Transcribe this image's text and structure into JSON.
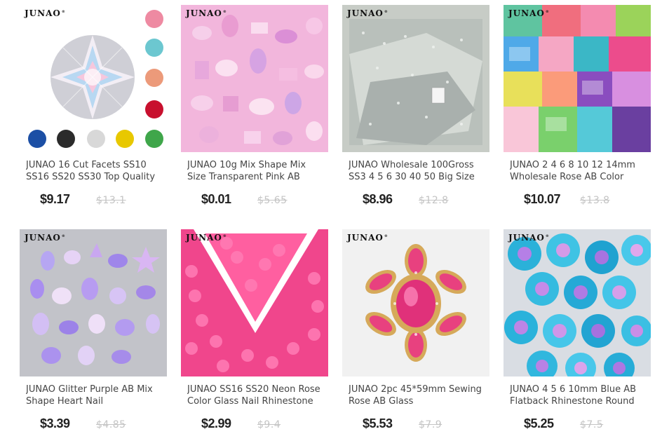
{
  "brand_mark": "JUNAO",
  "products": [
    {
      "title": "JUNAO 16 Cut Facets SS10 SS16 SS20 SS30 Top Quality",
      "price": "$9.17",
      "old_price": "$13.1",
      "image": "ab-crystal-with-color-swatches"
    },
    {
      "title": "JUNAO 10g Mix Shape Mix Size Transparent Pink AB",
      "price": "$0.01",
      "old_price": "$5.65",
      "image": "pink-ab-mixed-shapes"
    },
    {
      "title": "JUNAO Wholesale 100Gross SS3 4 5 6 30 40 50 Big Size",
      "price": "$8.96",
      "old_price": "$12.8",
      "image": "silver-ab-bulk-bags"
    },
    {
      "title": "JUNAO 2 4 6 8 10 12 14mm Wholesale Rose AB Color",
      "price": "$10.07",
      "old_price": "$13.8",
      "image": "multicolor-bags"
    },
    {
      "title": "JUNAO Glitter Purple AB Mix Shape Heart Nail",
      "price": "$3.39",
      "old_price": "$4.85",
      "image": "purple-ab-mixed-shapes"
    },
    {
      "title": "JUNAO SS16 SS20 Neon Rose Color Glass Nail Rhinestone",
      "price": "$2.99",
      "old_price": "$9.4",
      "image": "neon-rose-rhinestones"
    },
    {
      "title": "JUNAO 2pc 45*59mm Sewing Rose AB Glass",
      "price": "$5.53",
      "old_price": "$7.9",
      "image": "rose-ab-applique"
    },
    {
      "title": "JUNAO 4 5 6 10mm Blue AB Flatback Rhinestone Round",
      "price": "$5.25",
      "old_price": "$7.5",
      "image": "blue-ab-cones"
    }
  ],
  "colors": {
    "title_text": "#444444",
    "price_text": "#222222",
    "old_price_text": "#c4c4c4",
    "swatches": [
      "#ee8aa2",
      "#6cc7d0",
      "#ec9a7a",
      "#c8102e",
      "#1c4fa5",
      "#2b2b2b",
      "#d8d8d8",
      "#e8c800",
      "#3fa64a"
    ]
  }
}
